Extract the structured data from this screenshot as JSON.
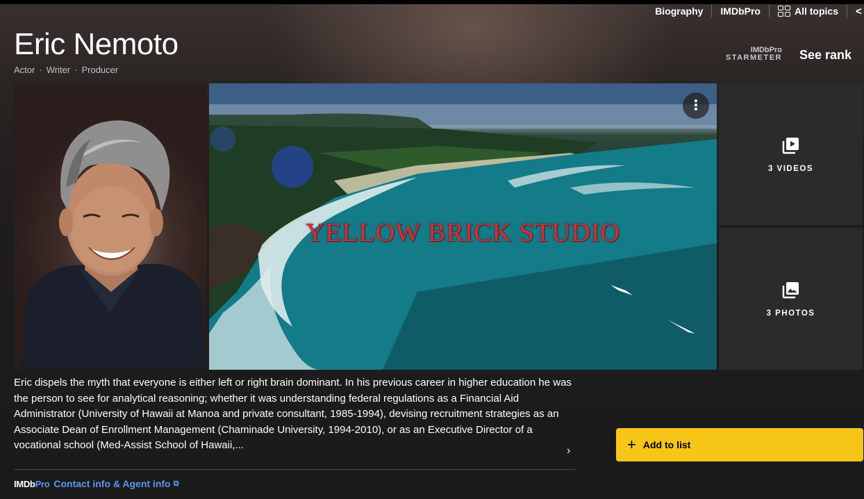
{
  "nav": {
    "biography": "Biography",
    "imdbpro": "IMDbPro",
    "all_topics": "All topics",
    "share_icon": "share-icon"
  },
  "person": {
    "name": "Eric Nemoto",
    "roles": [
      "Actor",
      "Writer",
      "Producer"
    ],
    "role_separator": "·"
  },
  "starmeter": {
    "brand": "IMDbPro",
    "label": "STARMETER",
    "see_rank": "See rank"
  },
  "video": {
    "overlay_text": "YELLOW BRICK STUDIO",
    "more_icon": "more-vertical-icon"
  },
  "tiles": {
    "videos": {
      "icon": "play-library-icon",
      "label": "3 VIDEOS"
    },
    "photos": {
      "icon": "photo-library-icon",
      "label": "3 PHOTOS"
    }
  },
  "bio": {
    "text": "Eric dispels the myth that everyone is either left or right brain dominant. In his previous career in higher education he was the person to see for analytical reasoning; whether it was understanding federal regulations as a Financial Aid Administrator (University of Hawaii at Manoa and private consultant, 1985-1994), devising recruitment strategies as an Associate Dean of Enrollment Management (Chaminade University, 1994-2010), or as an Executive Director of a vocational school (Med-Assist School of Hawaii,...",
    "expand_icon": "chevron-right-icon"
  },
  "pro": {
    "logo_imdb": "IMDb",
    "logo_pro": "Pro",
    "contact": "Contact info & Agent info",
    "external_icon": "external-link-icon"
  },
  "actions": {
    "add_to_list": "Add to list"
  },
  "colors": {
    "accent_yellow": "#f5c518",
    "link_blue": "#5799ef",
    "tile_bg": "#2b2b2b",
    "studio_red": "#e0282f"
  }
}
